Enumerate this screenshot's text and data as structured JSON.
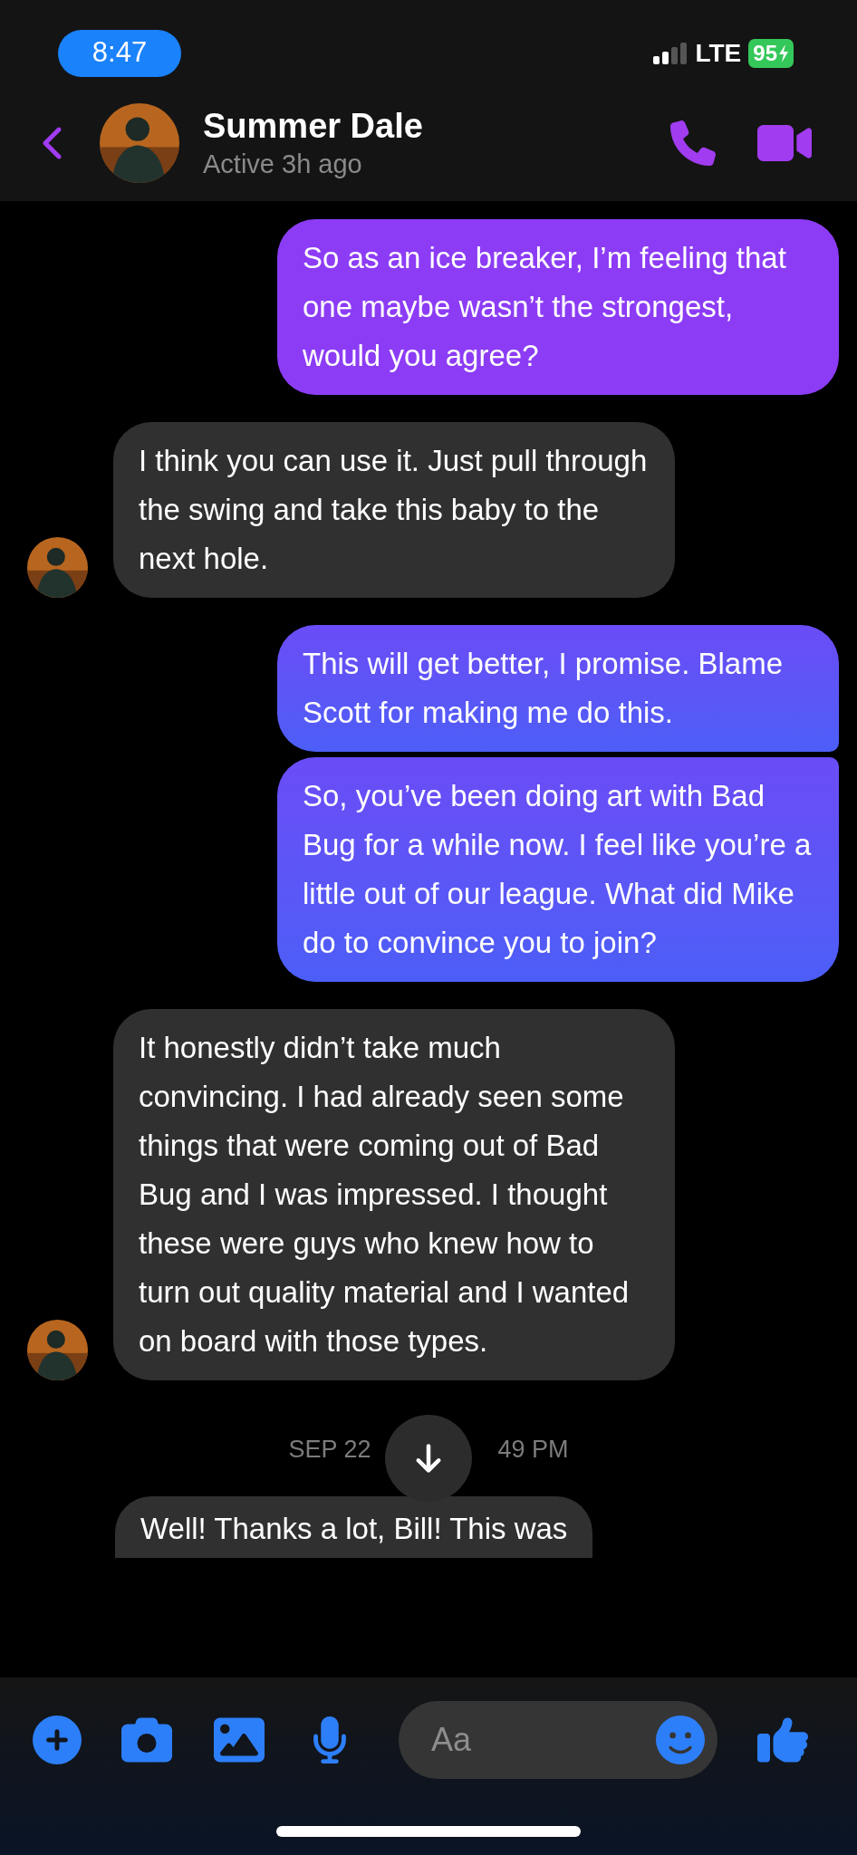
{
  "status_bar": {
    "time": "8:47",
    "network": "LTE",
    "battery": "95"
  },
  "header": {
    "name": "Summer Dale",
    "status": "Active 3h ago"
  },
  "messages": [
    {
      "kind": "sent",
      "text": "So as an ice breaker, I’m feeling that one maybe wasn’t the strongest, would you agree?"
    },
    {
      "kind": "received",
      "text": "I think you can use it. Just pull through the swing and take this baby to the next hole.",
      "avatar": true
    },
    {
      "kind": "sent",
      "text": "This will get better, I promise. Blame Scott for making me do this."
    },
    {
      "kind": "sent",
      "text": "So, you’ve been doing art with Bad Bug for a while now. I feel like you’re a little out of our league. What did Mike do to convince you to join?"
    },
    {
      "kind": "received",
      "text": "It honestly didn’t take much convincing. I had already seen some things that were coming out of Bad Bug and I was impressed. I thought these were guys who knew how to turn out quality material and I wanted on board with those types.",
      "avatar": true
    }
  ],
  "timestamp": {
    "left": "SEP 22",
    "right": "49 PM"
  },
  "last_message": {
    "text": "Well! Thanks a lot, Bill! This was"
  },
  "composer": {
    "placeholder": "Aa"
  }
}
